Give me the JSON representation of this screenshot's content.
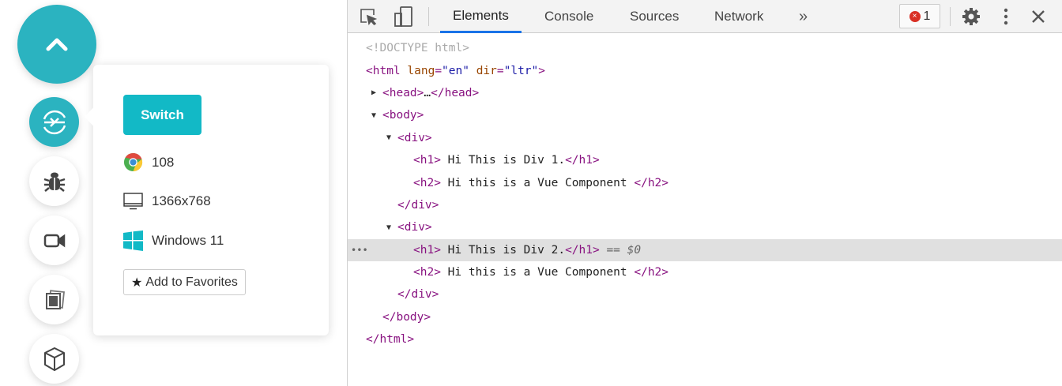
{
  "widget": {
    "switch_label": "Switch",
    "browser_version": "108",
    "resolution": "1366x768",
    "os": "Windows 11",
    "favorites_label": "Add to Favorites",
    "accent": "#2bb3c0"
  },
  "devtools": {
    "tabs": [
      "Elements",
      "Console",
      "Sources",
      "Network"
    ],
    "more": "»",
    "error_count": "1",
    "error_mark": "×",
    "selected_suffix": " == $0",
    "dots": "•••",
    "lines": [
      {
        "indent": 0,
        "segs": [
          [
            "doc",
            "<!DOCTYPE html>"
          ]
        ]
      },
      {
        "indent": 0,
        "segs": [
          [
            "tag",
            "<html "
          ],
          [
            "attr",
            "lang"
          ],
          [
            "tag",
            "="
          ],
          [
            "val",
            "\"en\""
          ],
          [
            "tag",
            " "
          ],
          [
            "attr",
            "dir"
          ],
          [
            "tag",
            "="
          ],
          [
            "val",
            "\"ltr\""
          ],
          [
            "tag",
            ">"
          ]
        ]
      },
      {
        "indent": 1,
        "arrow": "▶",
        "segs": [
          [
            "tag",
            "<head>"
          ],
          [
            "txt",
            "…"
          ],
          [
            "tag",
            "</head>"
          ]
        ]
      },
      {
        "indent": 1,
        "arrow": "▼",
        "segs": [
          [
            "tag",
            "<body>"
          ]
        ]
      },
      {
        "indent": 2,
        "arrow": "▼",
        "segs": [
          [
            "tag",
            "<div>"
          ]
        ]
      },
      {
        "indent": 3,
        "segs": [
          [
            "tag",
            "<h1>"
          ],
          [
            "txt",
            " Hi This is Div 1."
          ],
          [
            "tag",
            "</h1>"
          ]
        ]
      },
      {
        "indent": 3,
        "segs": [
          [
            "tag",
            "<h2>"
          ],
          [
            "txt",
            " Hi this is a Vue Component "
          ],
          [
            "tag",
            "</h2>"
          ]
        ]
      },
      {
        "indent": 2,
        "segs": [
          [
            "tag",
            "</div>"
          ]
        ]
      },
      {
        "indent": 2,
        "arrow": "▼",
        "segs": [
          [
            "tag",
            "<div>"
          ]
        ]
      },
      {
        "indent": 3,
        "selected": true,
        "segs": [
          [
            "tag",
            "<h1>"
          ],
          [
            "txt",
            " Hi This is Div 2."
          ],
          [
            "tag",
            "</h1>"
          ]
        ]
      },
      {
        "indent": 3,
        "segs": [
          [
            "tag",
            "<h2>"
          ],
          [
            "txt",
            " Hi this is a Vue Component "
          ],
          [
            "tag",
            "</h2>"
          ]
        ]
      },
      {
        "indent": 2,
        "segs": [
          [
            "tag",
            "</div>"
          ]
        ]
      },
      {
        "indent": 1,
        "segs": [
          [
            "tag",
            "</body>"
          ]
        ]
      },
      {
        "indent": 0,
        "segs": [
          [
            "tag",
            "</html>"
          ]
        ]
      }
    ]
  }
}
